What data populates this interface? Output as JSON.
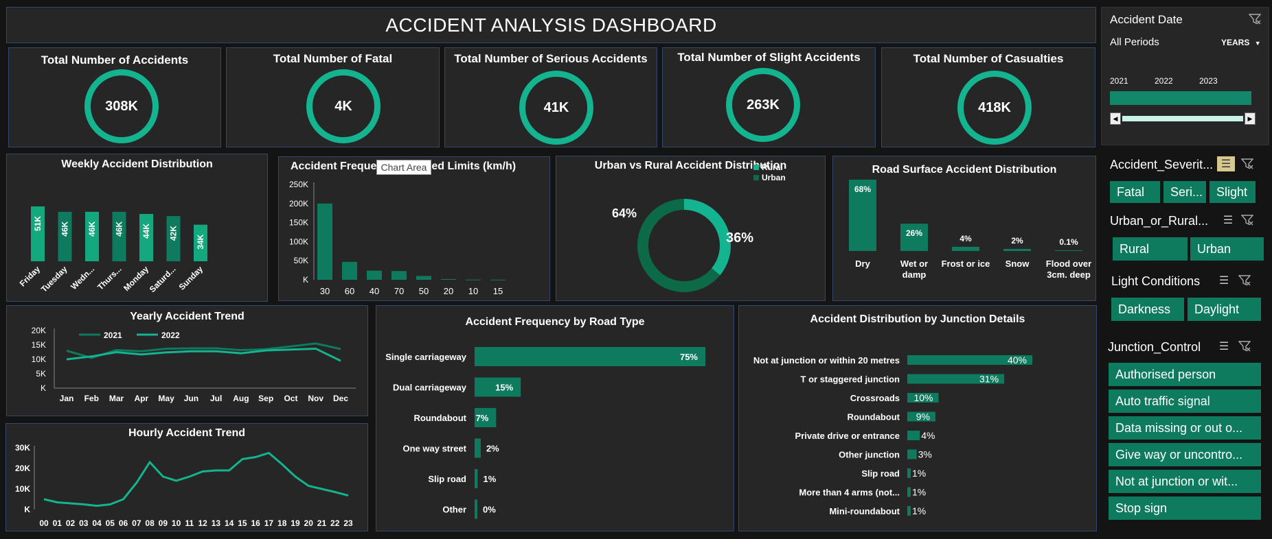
{
  "title": "ACCIDENT ANALYSIS DASHBOARD",
  "kpis": [
    {
      "title": "Total Number of Accidents",
      "value": "308K"
    },
    {
      "title": "Total Number of Fatal",
      "value": "4K"
    },
    {
      "title": "Total Number of Serious Accidents",
      "value": "41K"
    },
    {
      "title": "Total Number of Slight Accidents",
      "value": "263K"
    },
    {
      "title": "Total Number of Casualties",
      "value": "418K"
    }
  ],
  "tooltip": "Chart Area",
  "colors": {
    "accent": "#13b48f",
    "dark_green": "#0e7b5f",
    "mid_green": "#13a87d",
    "panel": "#262626"
  },
  "chart_data": [
    {
      "type": "bar",
      "title": "Weekly Accident Distribution",
      "categories": [
        "Friday",
        "Tuesday",
        "Wedn...",
        "Thurs...",
        "Monday",
        "Saturd...",
        "Sunday"
      ],
      "values": [
        51,
        46,
        46,
        46,
        44,
        42,
        34
      ],
      "labels": [
        "51K",
        "46K",
        "46K",
        "46K",
        "44K",
        "42K",
        "34K"
      ]
    },
    {
      "type": "bar",
      "title": "Accident Freque",
      "title_tail": "ed Limits (km/h)",
      "categories": [
        "30",
        "60",
        "40",
        "70",
        "50",
        "20",
        "10",
        "15"
      ],
      "values": [
        200000,
        47000,
        24000,
        23000,
        10000,
        2000,
        500,
        300
      ],
      "yticks": [
        "250K",
        "200K",
        "150K",
        "100K",
        "50K",
        "K"
      ],
      "ylim": [
        0,
        250000
      ]
    },
    {
      "type": "pie",
      "title": "Urban vs Rural Accident Distribution",
      "series": [
        {
          "name": "Rural",
          "value": 36,
          "label": "36%",
          "color": "#13b48f"
        },
        {
          "name": "Urban",
          "value": 64,
          "label": "64%",
          "color": "#0c6a48"
        }
      ]
    },
    {
      "type": "bar",
      "title": "Road Surface Accident Distribution",
      "categories": [
        "Dry",
        "Wet or damp",
        "Frost or ice",
        "Snow",
        "Flood over 3cm. deep"
      ],
      "values": [
        68,
        26,
        4,
        2,
        0.1
      ],
      "labels": [
        "68%",
        "26%",
        "4%",
        "2%",
        "0.1%"
      ]
    },
    {
      "type": "line",
      "title": "Yearly Accident Trend",
      "x": [
        "Jan",
        "Feb",
        "Mar",
        "Apr",
        "May",
        "Jun",
        "Jul",
        "Aug",
        "Sep",
        "Oct",
        "Nov",
        "Dec"
      ],
      "yticks": [
        "20K",
        "15K",
        "10K",
        "5K",
        "K"
      ],
      "ylim": [
        0,
        20000
      ],
      "series": [
        {
          "name": "2021",
          "color": "#0e7b5f",
          "values": [
            13000,
            10500,
            13200,
            12800,
            13700,
            13800,
            13800,
            13200,
            13500,
            14500,
            15500,
            13600
          ]
        },
        {
          "name": "2022",
          "color": "#13b48f",
          "values": [
            10000,
            11000,
            12500,
            11700,
            12400,
            12800,
            12800,
            12100,
            13100,
            13400,
            13700,
            9500
          ]
        }
      ]
    },
    {
      "type": "line",
      "title": "Hourly Accident Trend",
      "x": [
        "00",
        "01",
        "02",
        "03",
        "04",
        "05",
        "06",
        "07",
        "08",
        "09",
        "10",
        "11",
        "12",
        "13",
        "14",
        "15",
        "16",
        "17",
        "18",
        "19",
        "20",
        "21",
        "22",
        "23"
      ],
      "yticks": [
        "30K",
        "20K",
        "10K",
        "K"
      ],
      "ylim": [
        0,
        30000
      ],
      "series": [
        {
          "name": "Hourly",
          "color": "#13b48f",
          "values": [
            5000,
            3500,
            3000,
            2500,
            1800,
            2500,
            5000,
            13000,
            23000,
            16000,
            14000,
            16000,
            18500,
            19000,
            19000,
            24500,
            25500,
            27500,
            22000,
            16000,
            11500,
            10000,
            8500,
            6800
          ]
        }
      ]
    },
    {
      "type": "bar",
      "title": "Accident Frequency by Road Type",
      "categories": [
        "Single carriageway",
        "Dual carriageway",
        "Roundabout",
        "One way street",
        "Slip road",
        "Other"
      ],
      "values": [
        75,
        15,
        7,
        2,
        1,
        0
      ],
      "labels": [
        "75%",
        "15%",
        "7%",
        "2%",
        "1%",
        "0%"
      ]
    },
    {
      "type": "bar",
      "title": "Accident Distribution by Junction Details",
      "categories": [
        "Not at junction or within 20 metres",
        "T or staggered junction",
        "Crossroads",
        "Roundabout",
        "Private drive or entrance",
        "Other junction",
        "Slip road",
        "More than 4 arms (not...",
        "Mini-roundabout"
      ],
      "values": [
        40,
        31,
        10,
        9,
        4,
        3,
        1,
        1,
        1
      ],
      "labels": [
        "40%",
        "31%",
        "10%",
        "9%",
        "4%",
        "3%",
        "1%",
        "1%",
        "1%"
      ]
    }
  ],
  "timeline": {
    "title": "Accident Date",
    "period": "All Periods",
    "unit": "YEARS",
    "years": [
      "2021",
      "2022",
      "2023"
    ]
  },
  "slicers": {
    "severity": {
      "title": "Accident_Severit...",
      "items": [
        "Fatal",
        "Seri...",
        "Slight"
      ]
    },
    "urban": {
      "title": "Urban_or_Rural...",
      "items": [
        "Rural",
        "Urban"
      ]
    },
    "light": {
      "title": "Light Conditions",
      "items": [
        "Darkness",
        "Daylight"
      ]
    },
    "junction": {
      "title": "Junction_Control",
      "items": [
        "Authorised person",
        "Auto traffic signal",
        "Data missing or out o...",
        "Give way or uncontro...",
        "Not at junction or wit...",
        "Stop sign"
      ]
    }
  }
}
